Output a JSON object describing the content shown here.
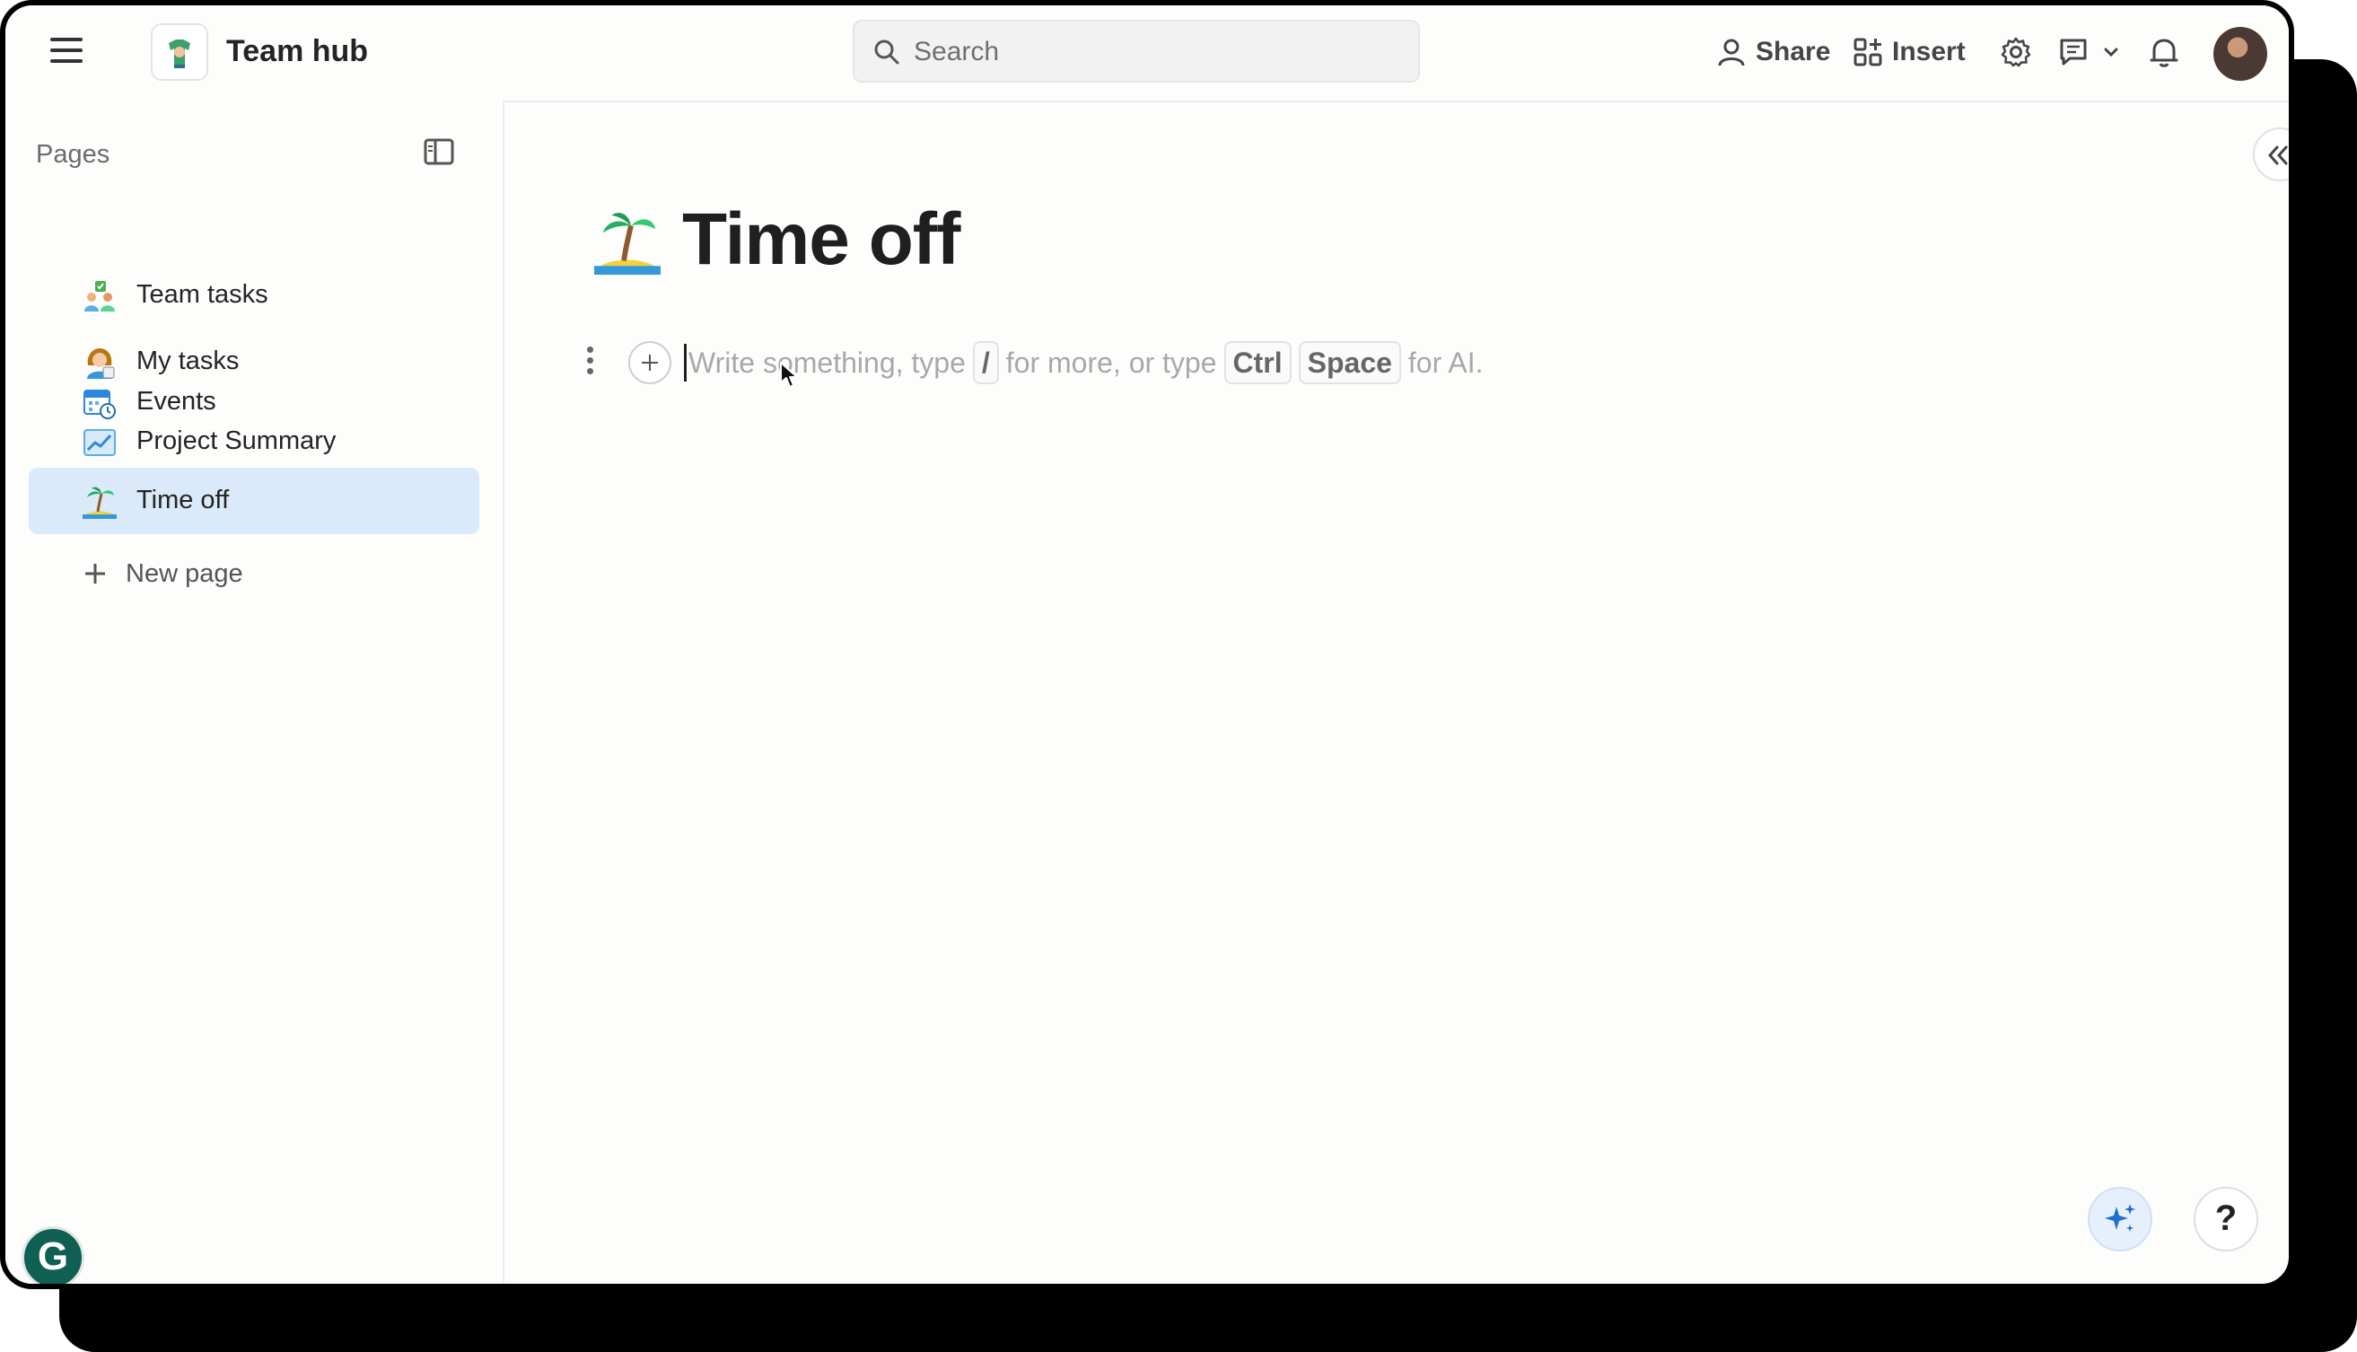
{
  "app": {
    "title": "Team hub"
  },
  "search": {
    "placeholder": "Search"
  },
  "toolbar": {
    "share_label": "Share",
    "insert_label": "Insert"
  },
  "sidebar": {
    "header": "Pages",
    "items": [
      {
        "label": "Team tasks",
        "icon": "team-tasks-emoji-icon"
      },
      {
        "label": "My tasks",
        "icon": "my-tasks-emoji-icon"
      },
      {
        "label": "Events",
        "icon": "calendar-clock-icon"
      },
      {
        "label": "Project Summary",
        "icon": "chart-icon"
      },
      {
        "label": "Time off",
        "icon": "palm-island-icon",
        "active": true
      }
    ],
    "new_page_label": "New page"
  },
  "page": {
    "title": "Time off",
    "editor_placeholder": {
      "part1": "Write something, type",
      "key_slash": "/",
      "part2": "for more, or type",
      "key_ctrl": "Ctrl",
      "key_space": "Space",
      "part3": "for AI."
    }
  },
  "floating": {
    "grammarly_label": "G",
    "help_label": "?"
  },
  "colors": {
    "active_nav_bg": "#dbeafa",
    "grammarly": "#0f5f52",
    "ai_button": "#1f6fd1"
  }
}
